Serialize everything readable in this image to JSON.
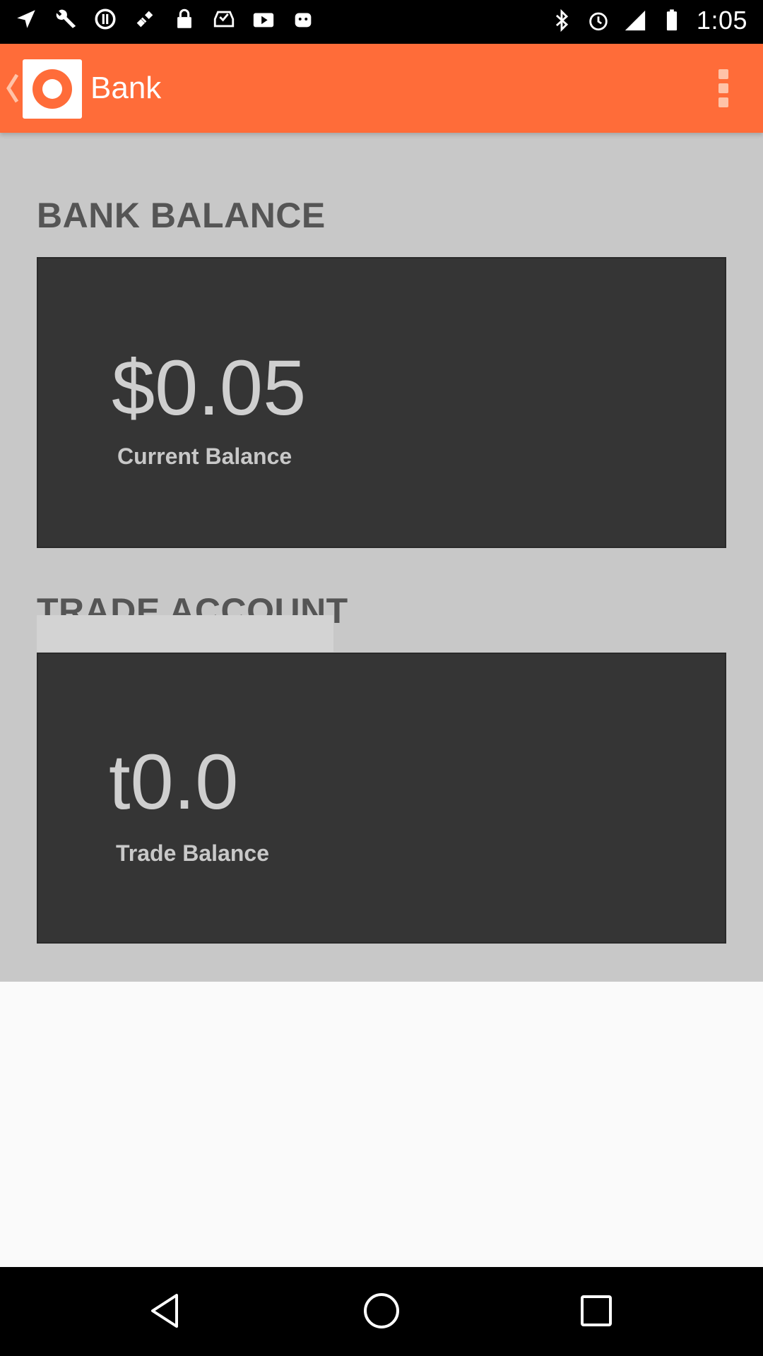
{
  "status_bar": {
    "time": "1:05",
    "left_icons": [
      "navigation-icon",
      "wrench-icon",
      "settings-circle-icon",
      "satellite-icon",
      "lock-icon",
      "inbox-check-icon",
      "video-play-icon",
      "android-icon"
    ],
    "right_icons": [
      "bluetooth-icon",
      "alarm-icon",
      "signal-icon",
      "battery-icon"
    ]
  },
  "action_bar": {
    "title": "Bank",
    "background": "#ff6c39"
  },
  "bank_section": {
    "heading": "BANK BALANCE",
    "amount": "$0.05",
    "label": "Current Balance"
  },
  "trade_section": {
    "heading": "TRADE ACCOUNT",
    "amount": "t0.0",
    "label": "Trade Balance"
  },
  "nav_bar": {
    "buttons": [
      "back-icon",
      "home-icon",
      "recents-icon"
    ]
  }
}
